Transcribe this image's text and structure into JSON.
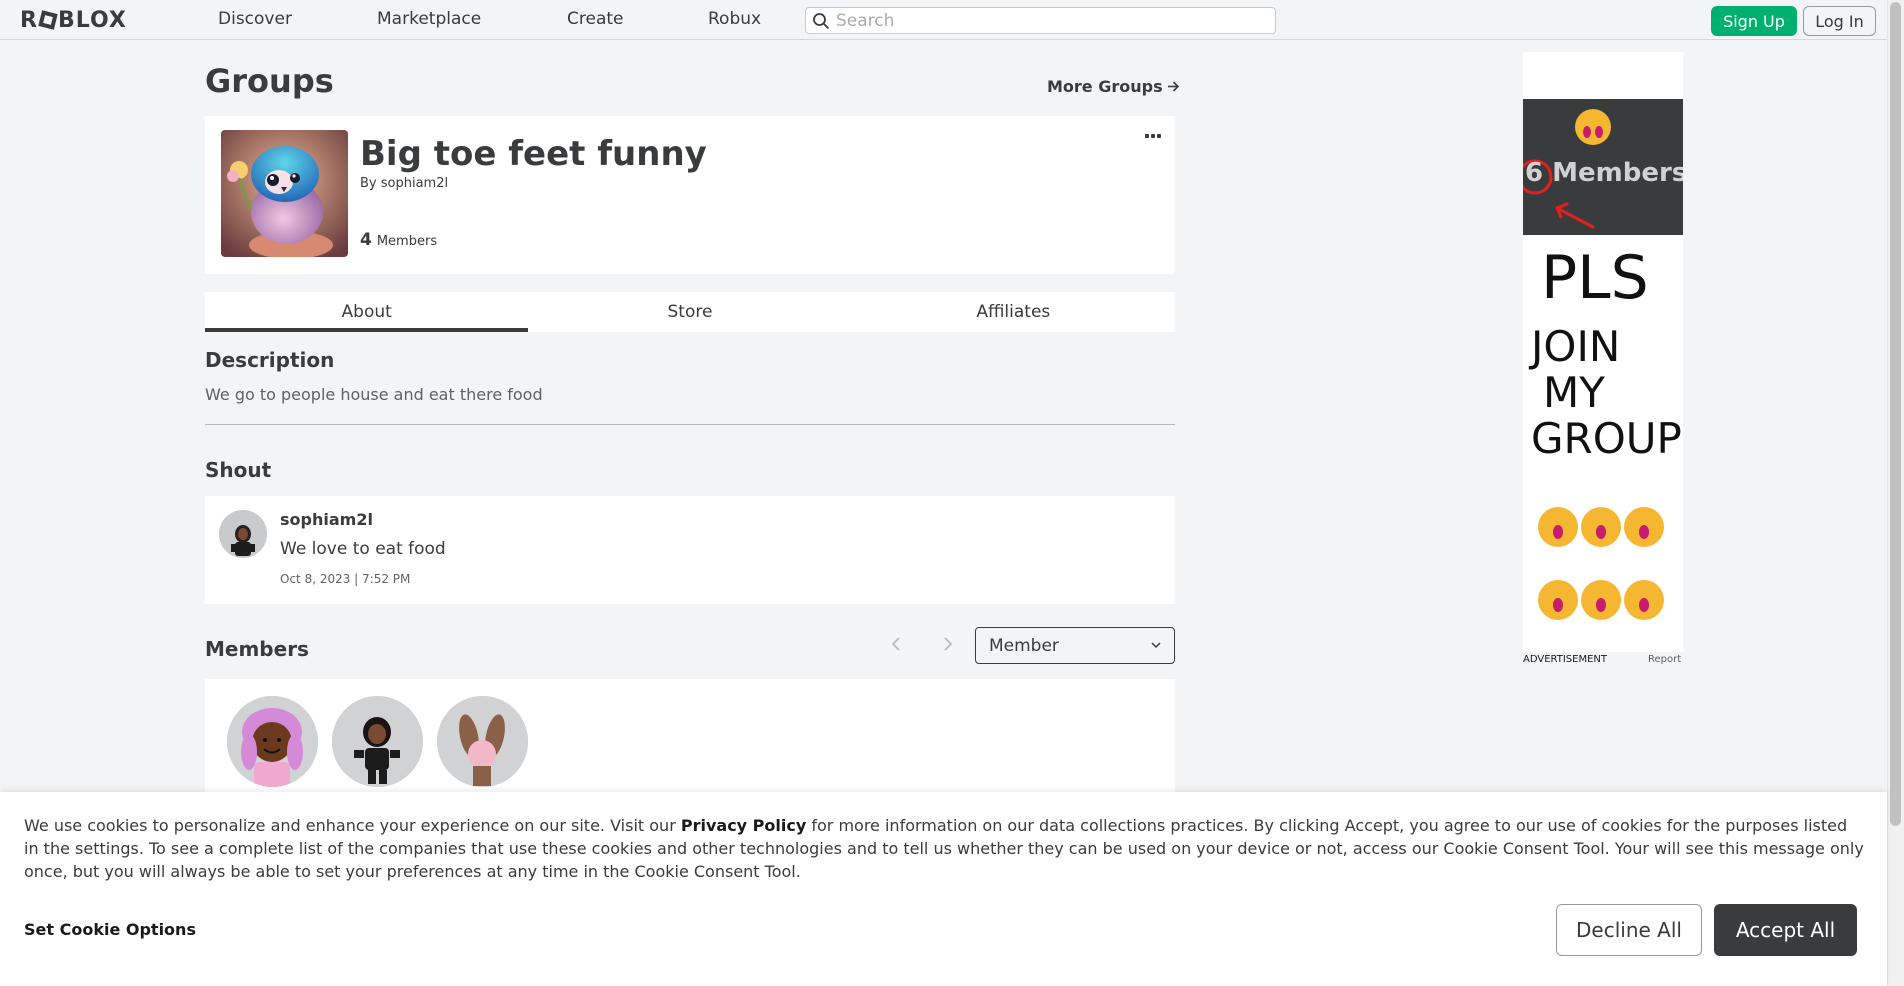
{
  "topbar": {
    "logo": "ROBLOX",
    "nav": [
      "Discover",
      "Marketplace",
      "Create",
      "Robux"
    ],
    "search_placeholder": "Search",
    "signup_label": "Sign Up",
    "login_label": "Log In"
  },
  "page": {
    "title": "Groups",
    "more_groups": "More Groups"
  },
  "group": {
    "name": "Big toe feet funny",
    "by_label": "By",
    "owner": "sophiam2l",
    "member_count": "4",
    "members_label": "Members"
  },
  "tabs": [
    {
      "label": "About",
      "active": true
    },
    {
      "label": "Store",
      "active": false
    },
    {
      "label": "Affiliates",
      "active": false
    }
  ],
  "about": {
    "description_heading": "Description",
    "description_text": "We go to people house and eat there food"
  },
  "shout": {
    "heading": "Shout",
    "user": "sophiam2l",
    "message": "We love to eat food",
    "time": "Oct 8, 2023 | 7:52 PM"
  },
  "members": {
    "heading": "Members",
    "role_selected": "Member"
  },
  "ad": {
    "count_text": "6 Members",
    "lines": [
      "PLS",
      "JOIN",
      "MY",
      "GROUP"
    ],
    "label": "ADVERTISEMENT",
    "report": "Report"
  },
  "cookie": {
    "text_before": "We use cookies to personalize and enhance your experience on our site. Visit our ",
    "privacy_link": "Privacy Policy",
    "text_after": " for more information on our data collections practices. By clicking Accept, you agree to our use of cookies for the purposes listed in the settings. To see a complete list of the companies that use these cookies and other technologies and to tell us whether they can be used on your device or not, access our Cookie Consent Tool. Your will see this message only once, but you will always be able to set your preferences at any time in the Cookie Consent Tool.",
    "options_label": "Set Cookie Options",
    "decline_label": "Decline All",
    "accept_label": "Accept All"
  },
  "colors": {
    "signup": "#00b06f",
    "accept": "#393b3d",
    "background": "#f2f4f5"
  }
}
